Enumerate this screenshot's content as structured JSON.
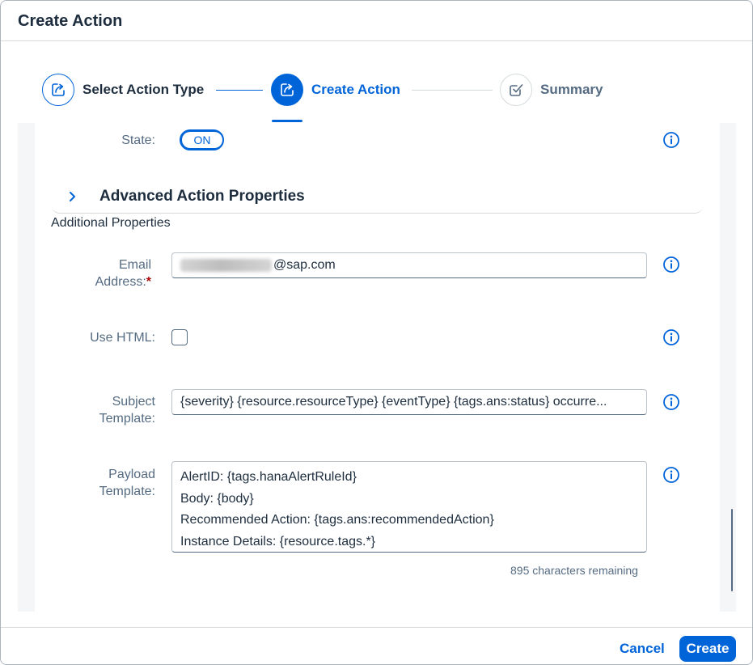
{
  "dialog": {
    "title": "Create Action"
  },
  "wizard": {
    "steps": [
      {
        "label": "Select Action Type",
        "icon": "share-icon",
        "status": "completed"
      },
      {
        "label": "Create Action",
        "icon": "share-icon",
        "status": "active"
      },
      {
        "label": "Summary",
        "icon": "checkbox-check-icon",
        "status": "upcoming"
      }
    ]
  },
  "form": {
    "state": {
      "label": "State:",
      "value": "ON"
    },
    "advanced_panel": {
      "title": "Advanced Action Properties",
      "expanded": false
    },
    "additional_properties_title": "Additional Properties",
    "email": {
      "label_line1": "Email",
      "label_line2": "Address:",
      "required_marker": "*",
      "value_visible": "@sap.com"
    },
    "use_html": {
      "label": "Use HTML:",
      "checked": false
    },
    "subject_template": {
      "label_line1": "Subject",
      "label_line2": "Template:",
      "value": "{severity} {resource.resourceType} {eventType} {tags.ans:status} occurre..."
    },
    "payload_template": {
      "label_line1": "Payload",
      "label_line2": "Template:",
      "lines": [
        "AlertID: {tags.hanaAlertRuleId}",
        "Body: {body}",
        "Recommended Action: {tags.ans:recommendedAction}",
        "Instance Details: {resource.tags.*}"
      ],
      "counter": "895 characters remaining"
    }
  },
  "footer": {
    "cancel_label": "Cancel",
    "create_label": "Create"
  },
  "colors": {
    "brand": "#0064d9",
    "text": "#1d2d3e",
    "label": "#556b82",
    "required": "#aa0808"
  }
}
